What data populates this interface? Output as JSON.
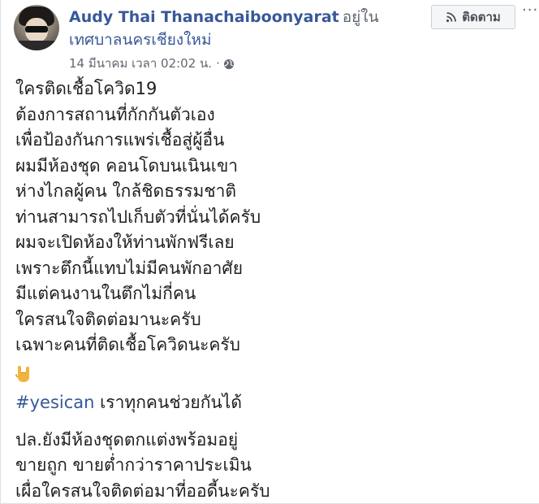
{
  "post": {
    "author": "Audy Thai Thanachaiboonyarat",
    "location_prefix": "อยู่ใน",
    "location": "เทศบาลนครเชียงใหม่",
    "timestamp": "14 มีนาคม เวลา 02:02 น.",
    "separator": "·",
    "privacy_icon": "globe-icon",
    "follow_label": "ติดตาม",
    "follow_icon": "rss-icon",
    "more_label": "···",
    "body_lines": [
      "ใครติดเชื้อโควิด19",
      "ต้องการสถานที่กักกันตัวเอง",
      "เพื่อป้องกันการแพร่เชื้อสู่ผู้อื่น",
      "ผมมีห้องชุด คอนโดบนเนินเขา",
      "ห่างไกลผู้คน ใกล้ชิดธรรมชาติ",
      "ท่านสามารถไปเก็บตัวที่นั่นได้ครับ",
      "ผมจะเปิดห้องให้ท่านพักฟรีเลย",
      "เพราะตึกนี้แทบไม่มีคนพักอาศัย",
      "มีแต่คนงานในตึกไม่กี่คน",
      "ใครสนใจติดต่อมานะครับ",
      "เฉพาะคนที่ติดเชื้อโควิดนะครับ"
    ],
    "emoji_icon": "rock-hand-emoji-icon",
    "hashtag": "#yesican",
    "hashtag_suffix": " เราทุกคนช่วยกันได้",
    "ps_lines": [
      "ปล.ยังมีห้องชุดตกแต่งพร้อมอยู่",
      "ขายถูก ขายต่ำกว่าราคาประเมิน",
      "เผื่อใครสนใจติดต่อมาที่ออดี้นะครับ"
    ]
  }
}
